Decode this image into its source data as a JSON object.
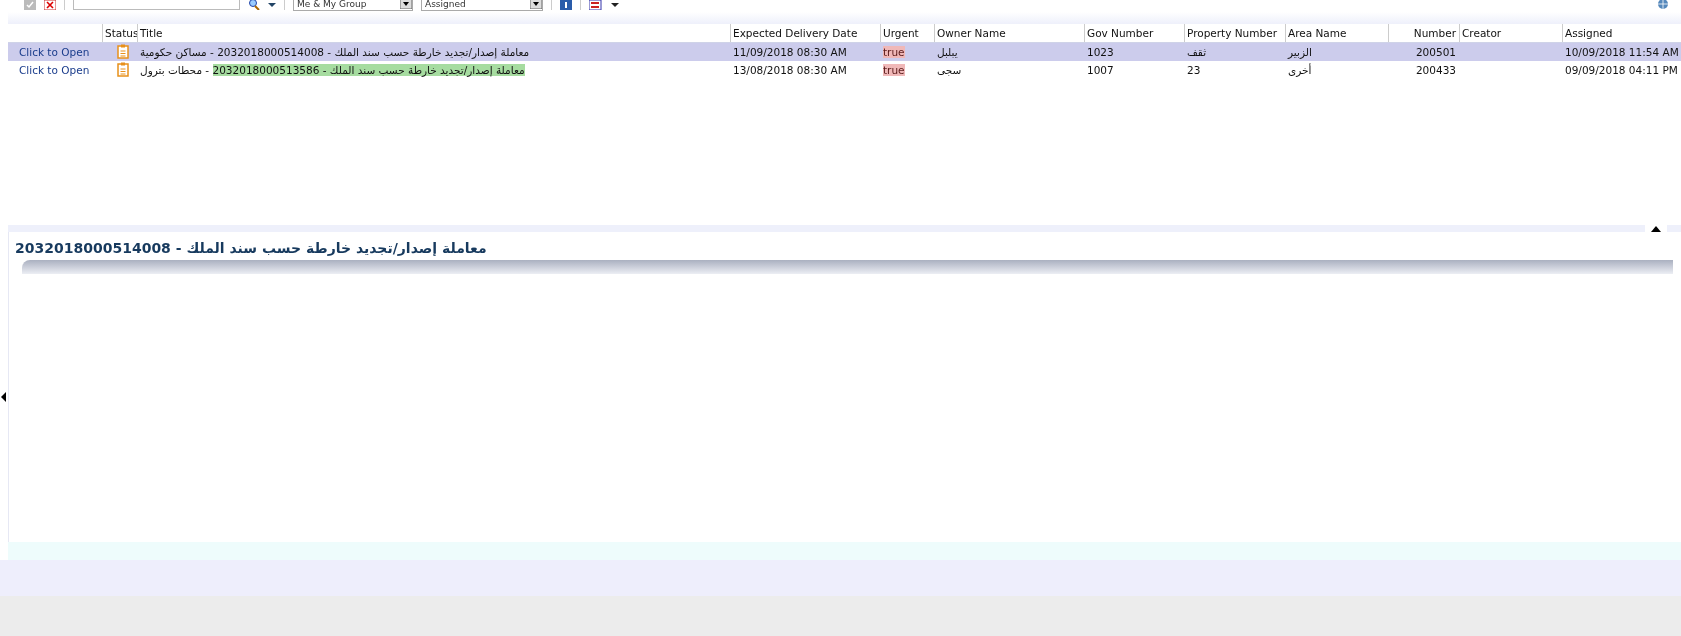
{
  "toolbar": {
    "filter_owner": {
      "value": "Me & My Group"
    },
    "filter_status": {
      "value": "Assigned"
    }
  },
  "table": {
    "columns": [
      {
        "kind": "link"
      },
      {
        "label": "Status",
        "kind": "icon"
      },
      {
        "label": "Title",
        "kind": "title"
      },
      {
        "label": "Expected Delivery Date",
        "kind": "text"
      },
      {
        "label": "Urgent",
        "kind": "flag"
      },
      {
        "label": "Owner Name",
        "kind": "text"
      },
      {
        "label": "Gov Number",
        "kind": "text"
      },
      {
        "label": "Property Number",
        "kind": "text"
      },
      {
        "label": "Area Name",
        "kind": "text"
      },
      {
        "label": "Number",
        "kind": "num"
      },
      {
        "label": "Creator",
        "kind": "blank"
      },
      {
        "label": "Assigned",
        "kind": "text"
      }
    ],
    "rows": [
      {
        "selected": true,
        "link": "Click to Open",
        "title": [
          {
            "text": "معاملة إصدار/تجديد خارطة حسب سند الملك - 2032018000514008 - مساكن حكومية",
            "highlighted": false
          }
        ],
        "values": [
          "11/09/2018 08:30 AM",
          "true",
          "يبلبل",
          "1023",
          "ثقف",
          "الزبير",
          "200501",
          "10/09/2018 11:54 AM"
        ]
      },
      {
        "selected": false,
        "link": "Click to Open",
        "title": [
          {
            "text": "معاملة إصدار/تجديد خارطة حسب سند الملك - 2032018000513586",
            "highlighted": true
          },
          {
            "text": " - محطات بترول",
            "highlighted": false
          }
        ],
        "values": [
          "13/08/2018 08:30 AM",
          "true",
          "سجى",
          "1007",
          "23",
          "أخرى",
          "200433",
          "09/09/2018 04:11 PM"
        ]
      }
    ]
  },
  "detail": {
    "title": "معاملة إصدار/تجديد خارطة حسب سند الملك - 2032018000514008"
  }
}
